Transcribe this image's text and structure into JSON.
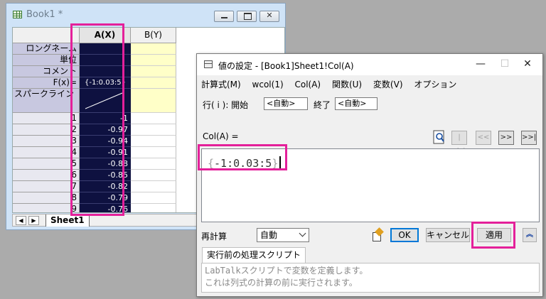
{
  "book": {
    "title": "Book1 *",
    "columns": [
      "A(X)",
      "B(Y)"
    ],
    "row_labels": [
      "ロングネーム",
      "単位",
      "コメント",
      "F(x)=",
      "スパークライン"
    ],
    "fx_value": "{-1:0.03:5}",
    "row_numbers": [
      "1",
      "2",
      "3",
      "4",
      "5",
      "6",
      "7",
      "8",
      "9"
    ],
    "values": [
      "-1",
      "-0.97",
      "-0.94",
      "-0.91",
      "-0.88",
      "-0.85",
      "-0.82",
      "-0.79",
      "-0.76"
    ],
    "sheet_tab": "Sheet1"
  },
  "dialog": {
    "title": "値の設定 - [Book1]Sheet1!Col(A)",
    "controls": {
      "minimize": "—",
      "maximize": "☐",
      "close": "✕"
    },
    "menu": [
      "計算式(M)",
      "wcol(1)",
      "Col(A)",
      "関数(U)",
      "変数(V)",
      "オプション"
    ],
    "range_label": "行( i ): 開始",
    "start_value": "<自動>",
    "end_label": "終了",
    "end_value": "<自動>",
    "col_label": "Col(A) =",
    "nav": [
      "|<<",
      "<<",
      ">>",
      ">>|"
    ],
    "formula": {
      "open": "{",
      "body": "-1:0.03:5",
      "close": "}"
    },
    "recalc_label": "再計算",
    "recalc_value": "自動",
    "ok_label": "OK",
    "cancel_label": "キャンセル",
    "apply_label": "適用",
    "script_tab": "実行前の処理スクリプト",
    "script_hint_mono": "LabTalk",
    "script_hint_1": "スクリプトで変数を定義します。",
    "script_hint_2": "これは列式の計算の前に実行されます。"
  },
  "colors": {
    "highlight": "#e4209a",
    "column_dark": "#0e1140",
    "meta_yellow": "#ffffc8"
  }
}
